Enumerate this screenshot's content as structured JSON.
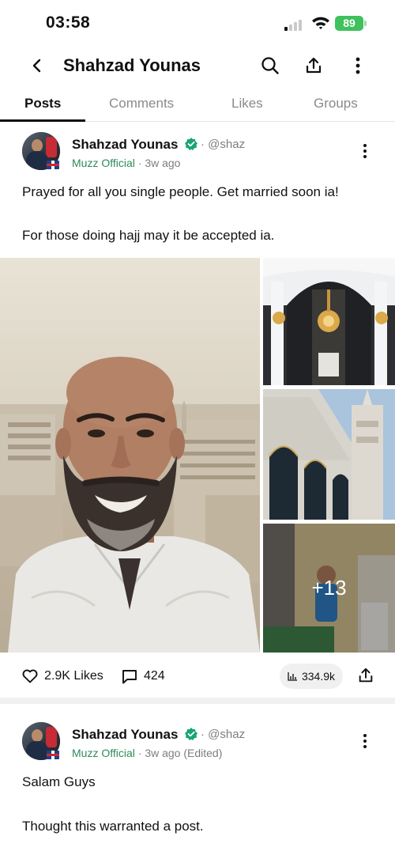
{
  "status_bar": {
    "time": "03:58",
    "battery": "89",
    "battery_color": "#3fc15e"
  },
  "header": {
    "title": "Shahzad Younas",
    "icons": [
      "back-icon",
      "search-icon",
      "share-icon",
      "more-icon"
    ]
  },
  "tabs": [
    {
      "label": "Posts",
      "active": true
    },
    {
      "label": "Comments",
      "active": false
    },
    {
      "label": "Likes",
      "active": false
    },
    {
      "label": "Groups",
      "active": false
    }
  ],
  "posts": [
    {
      "author": "Shahzad Younas",
      "verified": true,
      "handle": "@shaz",
      "separator": "·",
      "badge": "Muzz Official",
      "time": "3w ago",
      "text_lines": [
        "Prayed for all you single people. Get married soon ia!",
        "For those doing hajj may it be accepted ia."
      ],
      "photos_more": "+13",
      "likes": "2.9K Likes",
      "comments": "424",
      "views": "334.9k"
    },
    {
      "author": "Shahzad Younas",
      "verified": true,
      "handle": "@shaz",
      "separator": "·",
      "badge": "Muzz Official",
      "time": "3w ago (Edited)",
      "text_lines": [
        "Salam Guys",
        "Thought this warranted a post."
      ]
    }
  ],
  "colors": {
    "accent_green": "#2e8a5a",
    "verified_teal": "#1aa37a",
    "muted_text": "#7d7d7d"
  }
}
